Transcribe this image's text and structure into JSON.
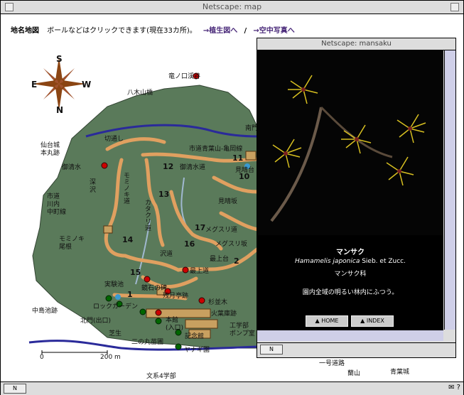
{
  "window": {
    "title": "Netscape: map"
  },
  "header": {
    "label": "地名地図",
    "instructions": "ボールなどはクリックできます(現在33カ所)。",
    "link1": "→植生図へ",
    "separator": "/",
    "link2": "→空中写真へ"
  },
  "compass": {
    "n": "N",
    "s": "S",
    "e": "E",
    "w": "W"
  },
  "scale": {
    "start": "0",
    "end": "200 m"
  },
  "map_labels": {
    "l1": "竜ノ口渓谷",
    "l2": "八木山橋",
    "l3": "仙台城\n本丸跡",
    "l4": "御清水",
    "l5": "深\n沢",
    "l6": "市道\n川内\n中町線",
    "l7": "モミノキ\n尾根",
    "l8": "切通し",
    "l9": "市道青葉山-​亀岡線",
    "l10": "御清水道",
    "l11": "モミノキ道",
    "l12": "カタクリ道",
    "l13": "見晴坂",
    "l14": "メグスリ道",
    "l15": "メグスリ坂",
    "l16": "沢道",
    "l17": "最上台",
    "l18": "最上道",
    "l19": "実験池",
    "l20": "鏡石の碑",
    "l21": "残月亭跡",
    "l22": "ロックガーデン",
    "l23": "杉並木",
    "l24": "中島池跡",
    "l25": "北門(出口)",
    "l26": "本館\n(入口)",
    "l27": "火葉庫跡",
    "l28": "芝生",
    "l29": "記念館",
    "l30": "ヤナギ園",
    "l31": "二の丸苗圃",
    "l32": "文系4学部",
    "l33": "工学部\nポンプ室",
    "l34": "一号道路",
    "l35": "蘭山",
    "l36": "青葉城",
    "l37": "見晴台",
    "l38": "南門"
  },
  "trail_numbers": [
    "11",
    "12",
    "13",
    "14",
    "15",
    "16",
    "17",
    "10",
    "2",
    "1"
  ],
  "popup": {
    "title": "Netscape: mansaku",
    "name_ja": "マンサク",
    "name_sci": "Hamamelis japonica",
    "author": "Sieb. et Zucc.",
    "family": "マンサク科",
    "description": "園内全域の明るい林内にふつう。",
    "home_button": "HOME",
    "index_button": "INDEX"
  },
  "colors": {
    "land": "#5a7a5a",
    "trail": "#e0a060",
    "river": "#2a2a9a",
    "marker_red": "#cc0000",
    "marker_green": "#006600",
    "link": "#4a2a7a"
  }
}
